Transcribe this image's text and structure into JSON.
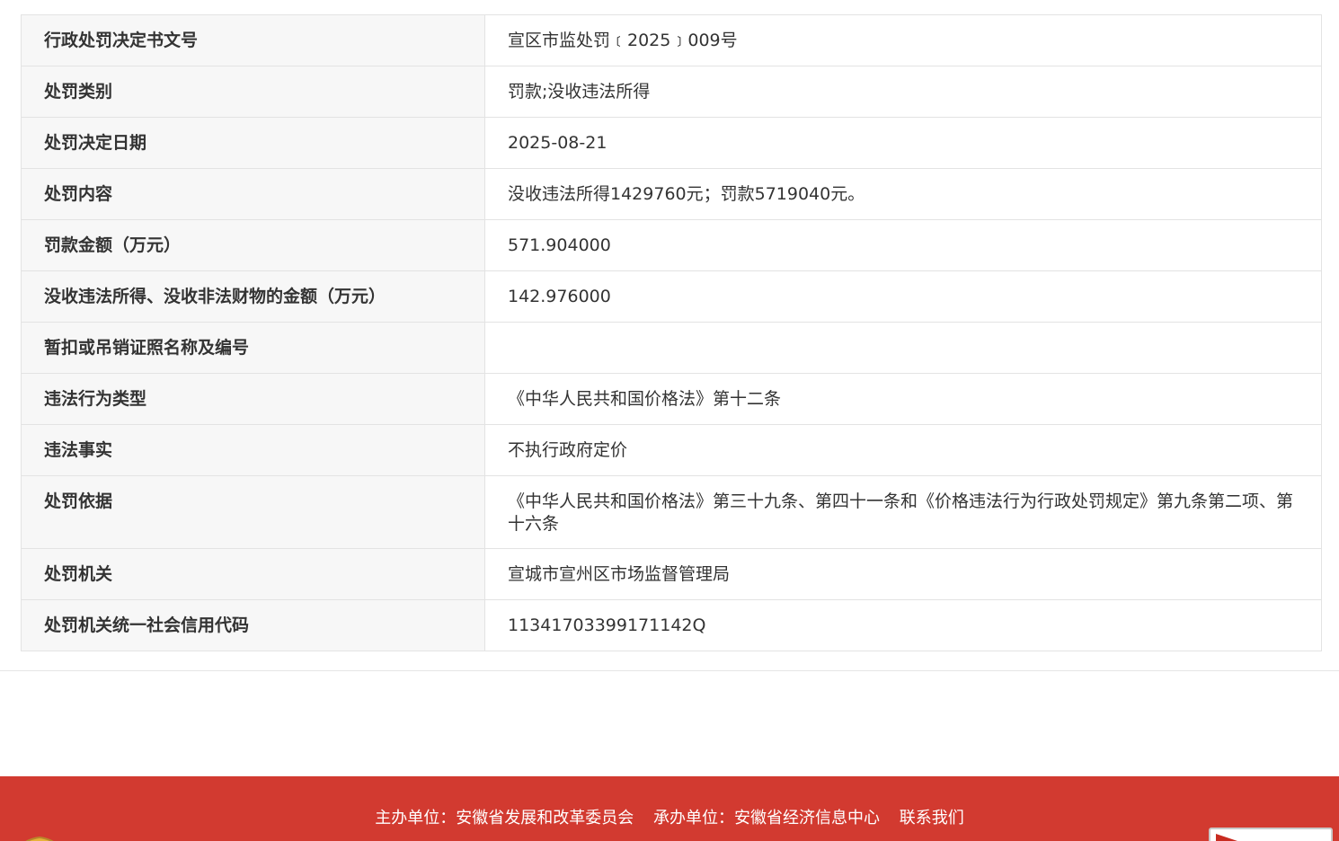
{
  "details": [
    {
      "label": "行政处罚决定书文号",
      "value": "宣区市监处罚﹝2025﹞009号"
    },
    {
      "label": "处罚类别",
      "value": "罚款;没收违法所得"
    },
    {
      "label": "处罚决定日期",
      "value": "2025-08-21"
    },
    {
      "label": "处罚内容",
      "value": "没收违法所得1429760元；罚款5719040元。"
    },
    {
      "label": "罚款金额（万元）",
      "value": "571.904000"
    },
    {
      "label": "没收违法所得、没收非法财物的金额（万元）",
      "value": "142.976000"
    },
    {
      "label": "暂扣或吊销证照名称及编号",
      "value": ""
    },
    {
      "label": "违法行为类型",
      "value": "《中华人民共和国价格法》第十二条"
    },
    {
      "label": "违法事实",
      "value": "不执行政府定价"
    },
    {
      "label": "处罚依据",
      "value": "《中华人民共和国价格法》第三十九条、第四十一条和《价格违法行为行政处罚规定》第九条第二项、第十六条"
    },
    {
      "label": "处罚机关",
      "value": "宣城市宣州区市场监督管理局"
    },
    {
      "label": "处罚机关统一社会信用代码",
      "value": "11341703399171142Q"
    }
  ],
  "footer": {
    "sponsor": "主办单位：安徽省发展和改革委员会",
    "organizer": "承办单位：安徽省经济信息中心",
    "contact": "联系我们"
  },
  "colors": {
    "footer_bg": "#d23a30",
    "key_cell_bg": "#f7f7f7",
    "border": "#e3e3e3"
  }
}
